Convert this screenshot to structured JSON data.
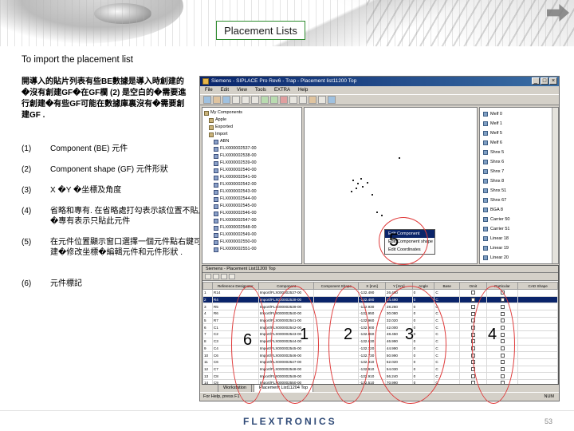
{
  "slide": {
    "title": "Placement Lists",
    "subtitle": "To import the placement list",
    "intro": "開導入的貼片列表有些BE數據是導入時創建的�沒有創建GF�在GF欄 (2) 是空白的�需要進行創建�有些GF可能在數據庫裏沒有�需要創建GF .",
    "steps": [
      {
        "num": "(1)",
        "text": "Component (BE) 元件"
      },
      {
        "num": "(2)",
        "text": "Component shape (GF) 元件形狀"
      },
      {
        "num": "(3)",
        "text": "X �Y �坐標及角度"
      },
      {
        "num": "(4)",
        "text": "省略和專有. 在省略處打勾表示該位置不貼片�專有表示只貼此元件"
      },
      {
        "num": "(5)",
        "text": "在元件位置顯示窗口選擇一個元件點右鍵可創建�修改坐標�編輯元件和元件形狀 ."
      },
      {
        "num": "(6)",
        "text": "元件標記"
      }
    ],
    "brand": "FLEXTRONICS",
    "page_number": "53"
  },
  "callouts": {
    "c5": "5",
    "c6": "6",
    "c1": "1",
    "c2": "2",
    "c3": "3",
    "c4": "4"
  },
  "app": {
    "window_title": "Siemens - SIPLACE Pro Rev6 - Trap - Placement list11200 Top",
    "menu": [
      "File",
      "Edit",
      "View",
      "Tools",
      "EXTRA",
      "Help"
    ],
    "tree": [
      "My Components",
      "Apple",
      "Exported",
      "Import",
      "ABN",
      "FLX000002537-00",
      "FLX000002538-00",
      "FLX000002539-00",
      "FLX000002540-00",
      "FLX000002541-00",
      "FLX000002542-00",
      "FLX000002543-00",
      "FLX000002544-00",
      "FLX000002545-00",
      "FLX000002546-00",
      "FLX000002547-00",
      "FLX000002548-00",
      "FLX000002549-00",
      "FLX000002550-00",
      "FLX000002551-00"
    ],
    "context_menu": [
      "Edit Component",
      "Edit Component shape",
      "Edit Coordinates"
    ],
    "shape_list": [
      "Melf 0",
      "Melf 1",
      "Melf 5",
      "Melf 6",
      "Shnx 5",
      "Shnx 6",
      "Shnx 7",
      "Shnx 8",
      "Shnx 51",
      "Shnx 67",
      "BGA 8",
      "Carrier 50",
      "Carrier 51",
      "Linear 18",
      "Linear 19",
      "Linear 20"
    ],
    "sub_window_title": "Siemens - Placement List11200 Top",
    "table": {
      "headers": [
        "",
        "Reference Designator",
        "Component",
        "Component Shape",
        "X [mm]",
        "Y [mm]",
        "Angle",
        "Base",
        "Omit",
        "Particular",
        "CAD Shape"
      ],
      "rows": [
        [
          "1",
          "R14",
          "Import/FLX000002537-00",
          "",
          "-132.490",
          "26.460",
          "0",
          "C",
          "",
          "",
          ""
        ],
        [
          "2",
          "R4",
          "Import/FLX000002538-00",
          "",
          "-132.490",
          "24.490",
          "0",
          "C",
          "",
          "",
          ""
        ],
        [
          "3",
          "R5",
          "Import/FLX000002539-00",
          "",
          "-132.930",
          "28.280",
          "0",
          "C",
          "",
          "",
          ""
        ],
        [
          "4",
          "R6",
          "Import/FLX000002540-00",
          "",
          "-132.950",
          "30.080",
          "0",
          "C",
          "",
          "",
          ""
        ],
        [
          "5",
          "R7",
          "Import/FLX000002541-00",
          "",
          "-132.960",
          "32.020",
          "0",
          "C",
          "",
          "",
          ""
        ],
        [
          "6",
          "C1",
          "Import/FLX000002542-00",
          "",
          "-132.900",
          "42.000",
          "0",
          "C",
          "",
          "",
          ""
        ],
        [
          "7",
          "C2",
          "Import/FLX000002543-00",
          "",
          "-132.860",
          "48.450",
          "0",
          "C",
          "",
          "",
          ""
        ],
        [
          "8",
          "C3",
          "Import/FLX000002544-00",
          "",
          "-132.630",
          "46.990",
          "0",
          "C",
          "",
          "",
          ""
        ],
        [
          "9",
          "C4",
          "Import/FLX000002545-00",
          "",
          "-132.720",
          "44.990",
          "0",
          "C",
          "",
          "",
          ""
        ],
        [
          "10",
          "C6",
          "Import/FLX000002546-00",
          "",
          "-132.730",
          "50.990",
          "0",
          "C",
          "",
          "",
          ""
        ],
        [
          "11",
          "C6",
          "Import/FLX000002547-00",
          "",
          "-132.910",
          "52.020",
          "0",
          "C",
          "",
          "",
          ""
        ],
        [
          "12",
          "C7",
          "Import/FLX000002548-00",
          "",
          "-132.910",
          "54.030",
          "0",
          "C",
          "",
          "",
          ""
        ],
        [
          "13",
          "C8",
          "Import/FLX000002549-00",
          "",
          "-132.910",
          "56.240",
          "0",
          "C",
          "",
          "",
          ""
        ],
        [
          "14",
          "C9",
          "Import/FLX000002550-00",
          "",
          "-132.510",
          "70.990",
          "0",
          "C",
          "",
          "",
          ""
        ],
        [
          "15",
          "C12",
          "Import/FLX000002551-00",
          "",
          "-132.520",
          "72.000",
          "0",
          "C",
          "",
          "",
          ""
        ],
        [
          "16",
          "C10",
          "Import/FLX000002552-00",
          "",
          "-132.480",
          "74.000",
          "0",
          "C",
          "",
          "",
          ""
        ],
        [
          "17",
          "C11",
          "Import/FLX000002553-00",
          "",
          "-132.480",
          "76.010",
          "0",
          "C",
          "",
          "",
          ""
        ]
      ]
    },
    "tabs": [
      "Workstation",
      "Placement List11204 Top"
    ],
    "status_left": "For Help, press F1",
    "status_right": "NUM"
  }
}
